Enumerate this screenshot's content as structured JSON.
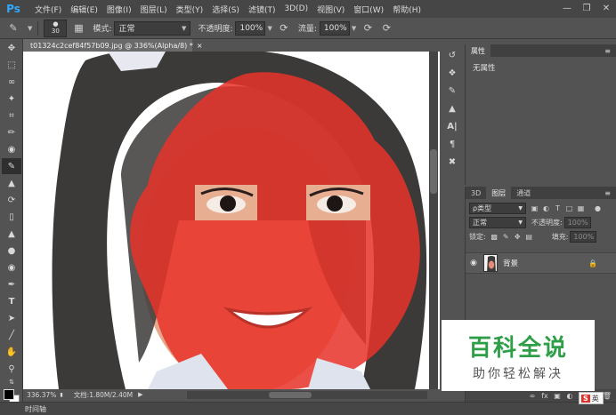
{
  "menubar": {
    "logo": "Ps",
    "items": [
      "文件(F)",
      "编辑(E)",
      "图像(I)",
      "图层(L)",
      "类型(Y)",
      "选择(S)",
      "滤镜(T)",
      "3D(D)",
      "视图(V)",
      "窗口(W)",
      "帮助(H)"
    ]
  },
  "options": {
    "brush_size": "30",
    "mode_label": "模式:",
    "mode_value": "正常",
    "opacity_label": "不透明度:",
    "opacity_value": "100%",
    "flow_label": "流量:",
    "flow_value": "100%"
  },
  "document": {
    "tab_title": "t01324c2cef84f57b09.jpg @ 336%(Alpha/8) *",
    "close_glyph": "×"
  },
  "status": {
    "zoom": "336.37%",
    "doc_info": "文档:1.80M/2.40M",
    "timeline": "时间轴"
  },
  "properties": {
    "tab_label": "属性",
    "body_text": "无属性"
  },
  "layers": {
    "tabs": [
      "3D",
      "图层",
      "通道"
    ],
    "kind_filter": "ρ类型",
    "blend_mode": "正常",
    "opacity_label": "不透明度:",
    "opacity_value": "100%",
    "lock_label": "锁定:",
    "fill_label": "填充:",
    "fill_value": "100%",
    "layer_name": "背景"
  },
  "watermark": {
    "title": "百科全说",
    "subtitle": "助你轻松解决"
  },
  "ime": {
    "brand": "S",
    "lang": "英"
  },
  "colors": {
    "brand_green": "#2f9e48",
    "mask_red": "#e8332a",
    "ps_blue": "#31a8ff"
  }
}
